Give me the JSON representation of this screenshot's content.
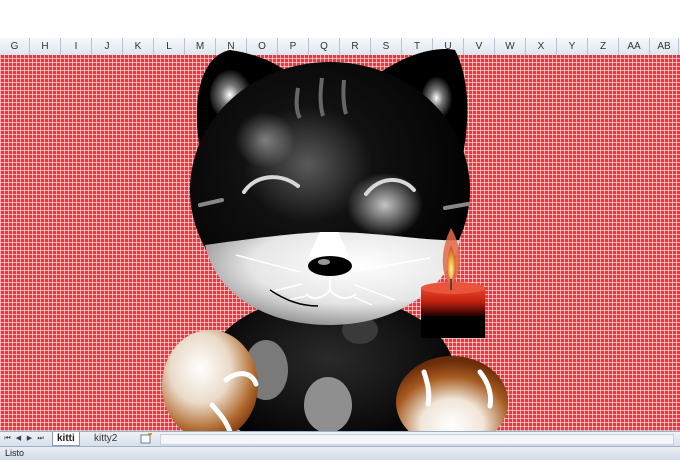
{
  "columns": [
    "G",
    "H",
    "I",
    "J",
    "K",
    "L",
    "M",
    "N",
    "O",
    "P",
    "Q",
    "R",
    "S",
    "T",
    "U",
    "V",
    "W",
    "X",
    "Y",
    "Z",
    "AA",
    "AB"
  ],
  "sheet_tabs": [
    {
      "label": "kitti",
      "active": true
    },
    {
      "label": "kitty2",
      "active": false
    }
  ],
  "status": {
    "text": "Listo"
  },
  "colors": {
    "sheet_fill": "#e8393e",
    "cat_body": "#000000",
    "candle": "#d0341b",
    "bun": "#9b4a1d"
  }
}
